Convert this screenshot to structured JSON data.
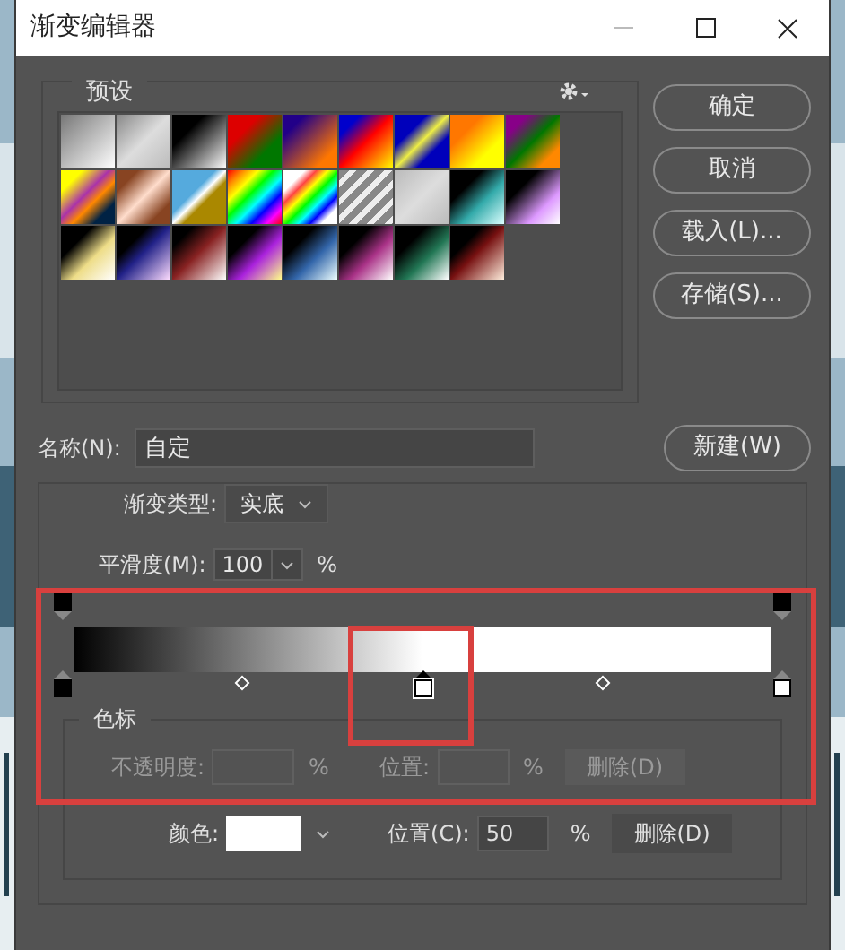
{
  "window": {
    "title": "渐变编辑器"
  },
  "presets": {
    "label": "预设"
  },
  "buttons": [
    "确定",
    "取消",
    "载入(L)...",
    "存储(S)..."
  ],
  "name_field": {
    "label": "名称(N):",
    "value": "自定"
  },
  "new_button": "新建(W)",
  "gradient_type": {
    "label": "渐变类型:",
    "value": "实底"
  },
  "smoothness": {
    "label": "平滑度(M):",
    "value": "100",
    "unit": "%"
  },
  "opacity_stops": [
    {
      "selected": false
    },
    {
      "selected": false
    }
  ],
  "color_stops": [
    {
      "color": "#000000",
      "selected": false
    },
    {
      "color": "#ffffff",
      "selected": true
    },
    {
      "color": "#ffffff",
      "selected": false
    }
  ],
  "stops_section": {
    "label": "色标",
    "opacity_row": {
      "disabled": true,
      "label": "不透明度:",
      "unit": "%",
      "position_label": "位置:",
      "position_unit": "%",
      "delete": "删除(D)"
    },
    "color_row": {
      "disabled": false,
      "label": "颜色:",
      "color": "#ffffff",
      "position_label": "位置(C):",
      "position_value": "50",
      "unit": "%",
      "delete": "删除(D)"
    }
  }
}
